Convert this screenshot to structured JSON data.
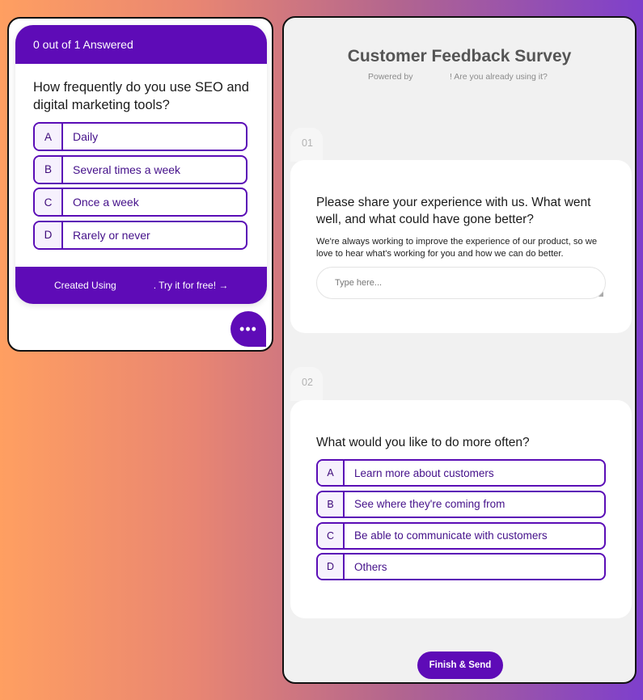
{
  "widget": {
    "progress_text": "0 out of 1 Answered",
    "question": "How frequently do you use SEO and digital marketing tools?",
    "options": [
      {
        "key": "A",
        "label": "Daily"
      },
      {
        "key": "B",
        "label": "Several times a week"
      },
      {
        "key": "C",
        "label": "Once a week"
      },
      {
        "key": "D",
        "label": "Rarely or never"
      }
    ],
    "footer_created": "Created Using",
    "footer_try": ". Try it for free! →",
    "more_icon": "•••"
  },
  "survey": {
    "title": "Customer Feedback Survey",
    "powered_by": "Powered by",
    "subtitle_tail": "! Are you already using it?",
    "q1": {
      "number": "01",
      "title": "Please share your experience with us. What went well, and what could have gone better?",
      "description": "We're always working to improve the experience of our product, so we love to hear what's working for you and how we can do better.",
      "placeholder": "Type here..."
    },
    "q2": {
      "number": "02",
      "title": "What would you like to do more often?",
      "options": [
        {
          "key": "A",
          "label": "Learn more about customers"
        },
        {
          "key": "B",
          "label": "See where they're coming from"
        },
        {
          "key": "C",
          "label": "Be able to communicate with customers"
        },
        {
          "key": "D",
          "label": "Others"
        }
      ]
    },
    "submit_label": "Finish & Send"
  },
  "colors": {
    "brand_purple": "#5e0bb7",
    "option_border": "#5a0db6",
    "option_text": "#44108a"
  }
}
